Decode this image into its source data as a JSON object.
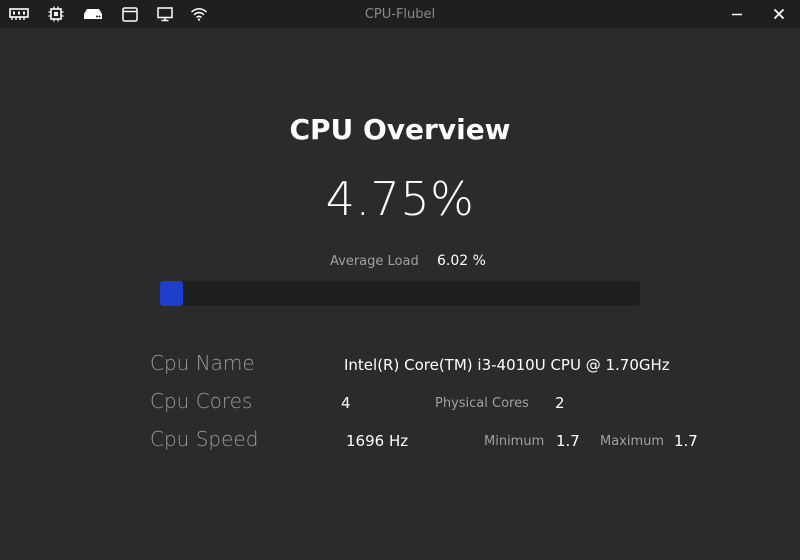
{
  "window": {
    "title": "CPU-Flubel"
  },
  "nav_icons": [
    {
      "name": "memory-icon"
    },
    {
      "name": "cpu-chip-icon"
    },
    {
      "name": "disk-drive-icon"
    },
    {
      "name": "window-icon"
    },
    {
      "name": "monitor-icon"
    },
    {
      "name": "wifi-icon"
    }
  ],
  "overview": {
    "title": "CPU Overview",
    "current_load": "4.75%",
    "average_label": "Average Load",
    "average_value": "6.02 %",
    "progress_fraction": 0.0475
  },
  "details": {
    "name_label": "Cpu Name",
    "name_value": "Intel(R) Core(TM) i3-4010U CPU @ 1.70GHz",
    "cores_label": "Cpu Cores",
    "cores_value": "4",
    "physical_cores_label": "Physical Cores",
    "physical_cores_value": "2",
    "speed_label": "Cpu Speed",
    "speed_value": "1696 Hz",
    "minimum_label": "Minimum",
    "minimum_value": "1.7",
    "maximum_label": "Maximum",
    "maximum_value": "1.7"
  },
  "colors": {
    "background": "#2b2b2b",
    "titlebar": "#1f1f1f",
    "progress_fill": "#1d3fcc"
  }
}
